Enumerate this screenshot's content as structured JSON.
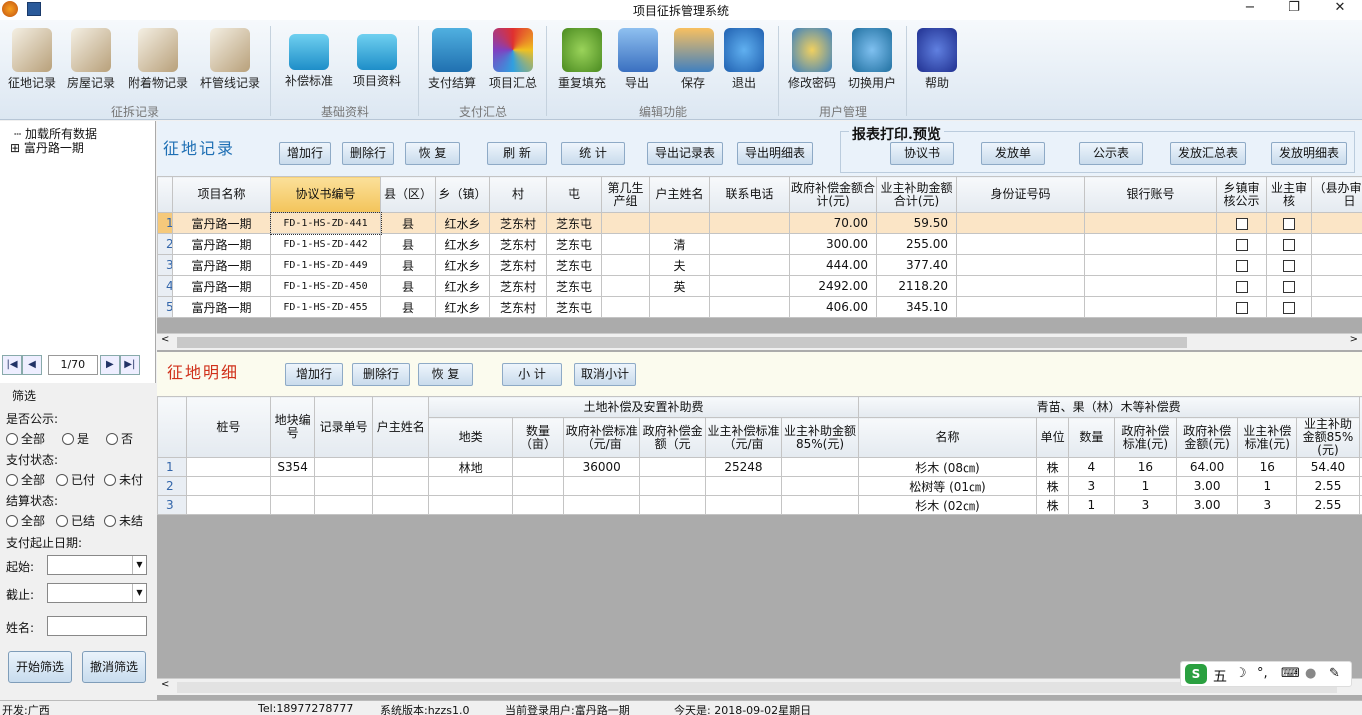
{
  "window": {
    "title": "项目征拆管理系统",
    "min": "−",
    "max": "❐",
    "close": "✕"
  },
  "ribbon": {
    "buttons": [
      {
        "label": "征地记录",
        "icon": "document-pen-icon"
      },
      {
        "label": "房屋记录",
        "icon": "document-pen-icon"
      },
      {
        "label": "附着物记录",
        "icon": "document-pen-icon"
      },
      {
        "label": "杆管线记录",
        "icon": "document-pen-icon"
      },
      {
        "label": "补偿标准",
        "icon": "folder-icon"
      },
      {
        "label": "项目资料",
        "icon": "folder-icon"
      },
      {
        "label": "支付结算",
        "icon": "yen-icon"
      },
      {
        "label": "项目汇总",
        "icon": "cube-icon"
      },
      {
        "label": "重复填充",
        "icon": "person-icon"
      },
      {
        "label": "导出",
        "icon": "export-icon"
      },
      {
        "label": "保存",
        "icon": "save-icon"
      },
      {
        "label": "退出",
        "icon": "exit-icon"
      },
      {
        "label": "修改密码",
        "icon": "key-icon"
      },
      {
        "label": "切换用户",
        "icon": "user-switch-icon"
      },
      {
        "label": "帮助",
        "icon": "help-icon"
      }
    ],
    "groups": [
      "征拆记录",
      "基础资料",
      "支付汇总",
      "编辑功能",
      "用户管理"
    ]
  },
  "tree": {
    "root": "加载所有数据",
    "child": "富丹路一期"
  },
  "pager": {
    "value": "1/70"
  },
  "filter": {
    "title": "筛选",
    "public_label": "是否公示:",
    "public_opts": [
      "全部",
      "是",
      "否"
    ],
    "pay_label": "支付状态:",
    "pay_opts": [
      "全部",
      "已付",
      "未付"
    ],
    "settle_label": "结算状态:",
    "settle_opts": [
      "全部",
      "已结",
      "未结"
    ],
    "date_label": "支付起止日期:",
    "start_label": "起始:",
    "end_label": "截止:",
    "name_label": "姓名:",
    "apply": "开始筛选",
    "cancel": "撤消筛选"
  },
  "top": {
    "title": "征地记录",
    "print_title": "报表打印.预览",
    "buttons": [
      "增加行",
      "删除行",
      "恢 复",
      "刷 新",
      "统 计",
      "导出记录表",
      "导出明细表"
    ],
    "print_buttons": [
      "协议书",
      "发放单",
      "公示表",
      "发放汇总表",
      "发放明细表"
    ],
    "columns": [
      "项目名称",
      "协议书编号",
      "县（区）",
      "乡（镇）",
      "村",
      "屯",
      "第几生产组",
      "户主姓名",
      "联系电话",
      "政府补偿金额合计(元)",
      "业主补助金额合计(元)",
      "身份证号码",
      "银行账号",
      "乡镇审核公示",
      "业主审核",
      "（县办审支付日"
    ],
    "rows": [
      {
        "n": "1",
        "proj": "富丹路一期",
        "no": "FD-1-HS-ZD-441",
        "county": "县",
        "town": "红水乡",
        "village": "芝东村",
        "tun": "芝东屯",
        "owner": "",
        "gov": "70.00",
        "biz": "59.50"
      },
      {
        "n": "2",
        "proj": "富丹路一期",
        "no": "FD-1-HS-ZD-442",
        "county": "县",
        "town": "红水乡",
        "village": "芝东村",
        "tun": "芝东屯",
        "owner": "清",
        "gov": "300.00",
        "biz": "255.00"
      },
      {
        "n": "3",
        "proj": "富丹路一期",
        "no": "FD-1-HS-ZD-449",
        "county": "县",
        "town": "红水乡",
        "village": "芝东村",
        "tun": "芝东屯",
        "owner": "夫",
        "gov": "444.00",
        "biz": "377.40"
      },
      {
        "n": "4",
        "proj": "富丹路一期",
        "no": "FD-1-HS-ZD-450",
        "county": "县",
        "town": "红水乡",
        "village": "芝东村",
        "tun": "芝东屯",
        "owner": "英",
        "gov": "2492.00",
        "biz": "2118.20"
      },
      {
        "n": "5",
        "proj": "富丹路一期",
        "no": "FD-1-HS-ZD-455",
        "county": "县",
        "town": "红水乡",
        "village": "芝东村",
        "tun": "芝东屯",
        "owner": "",
        "gov": "406.00",
        "biz": "345.10"
      }
    ]
  },
  "detail": {
    "title": "征地明细",
    "buttons": [
      "增加行",
      "删除行",
      "恢 复",
      "小 计",
      "取消小计"
    ],
    "group1": "土地补偿及安置补助费",
    "group2": "青苗、果（林）木等补偿费",
    "columns": [
      "桩号",
      "地块编号",
      "记录单号",
      "户主姓名",
      "地类",
      "数量（亩）",
      "政府补偿标准（元/亩",
      "政府补偿金额（元",
      "业主补偿标准（元/亩",
      "业主补助金额85%(元)",
      "名称",
      "单位",
      "数量",
      "政府补偿标准(元)",
      "政府补偿金额(元)",
      "业主补偿标准(元)",
      "业主补助金额85%(元)"
    ],
    "rows": [
      {
        "n": "1",
        "block": "S354",
        "land": "林地",
        "std": "36000",
        "bstd": "25248",
        "name": "杉木 (08㎝)",
        "unit": "株",
        "qty": "4",
        "gstd": "16",
        "gamt": "64.00",
        "bs": "16",
        "bamt": "54.40"
      },
      {
        "n": "2",
        "block": "",
        "land": "",
        "std": "",
        "bstd": "",
        "name": "松树等 (01㎝)",
        "unit": "株",
        "qty": "3",
        "gstd": "1",
        "gamt": "3.00",
        "bs": "1",
        "bamt": "2.55"
      },
      {
        "n": "3",
        "block": "",
        "land": "",
        "std": "",
        "bstd": "",
        "name": "杉木 (02㎝)",
        "unit": "株",
        "qty": "1",
        "gstd": "3",
        "gamt": "3.00",
        "bs": "3",
        "bamt": "2.55"
      }
    ]
  },
  "status": {
    "dev": "开发:广西",
    "tel": "Tel:18977278777",
    "version": "系统版本:hzzs1.0",
    "user": "当前登录用户:富丹路一期",
    "today": "今天是: 2018-09-02星期日"
  },
  "ime": {
    "label": "五"
  }
}
